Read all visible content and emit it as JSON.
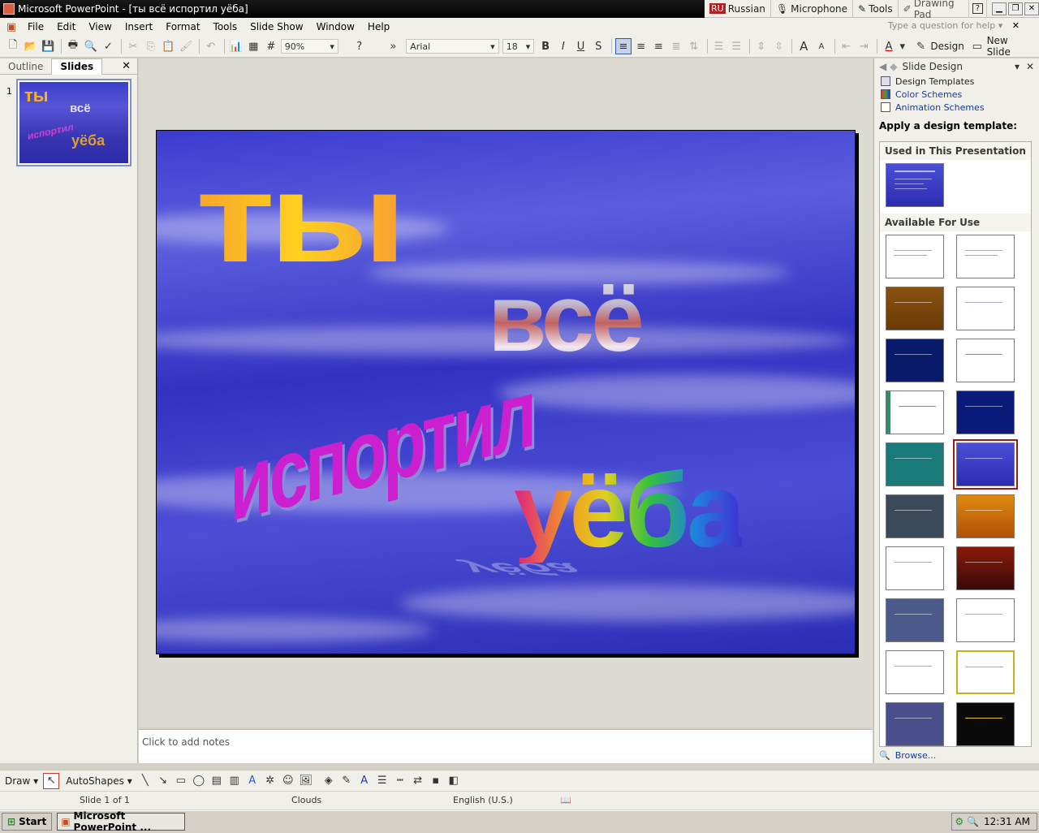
{
  "window": {
    "title": "Microsoft PowerPoint - [ты всё испортил уёба]"
  },
  "langbar": {
    "lang_code": "RU",
    "lang_name": "Russian",
    "microphone": "Microphone",
    "tools": "Tools",
    "drawing_pad": "Drawing Pad"
  },
  "menu": {
    "items": [
      "File",
      "Edit",
      "View",
      "Insert",
      "Format",
      "Tools",
      "Slide Show",
      "Window",
      "Help"
    ],
    "help_placeholder": "Type a question for help"
  },
  "toolbar": {
    "zoom": "90%",
    "font": "Arial",
    "size": "18",
    "design": "Design",
    "new_slide": "New Slide"
  },
  "leftpane": {
    "tabs": [
      "Outline",
      "Slides"
    ],
    "active_tab": "Slides",
    "slide_number": "1"
  },
  "slide": {
    "word1": "ты",
    "word2": "всё",
    "word3": "испортил",
    "word4": "уёба"
  },
  "notes": {
    "placeholder": "Click to add notes"
  },
  "taskpane": {
    "title": "Slide Design",
    "links": [
      "Design Templates",
      "Color Schemes",
      "Animation Schemes"
    ],
    "apply_label": "Apply a design template:",
    "used_section": "Used in This Presentation",
    "available_section": "Available For Use",
    "browse": "Browse..."
  },
  "drawbar": {
    "draw": "Draw",
    "autoshapes": "AutoShapes"
  },
  "status": {
    "slide": "Slide 1 of 1",
    "design": "Clouds",
    "language": "English (U.S.)"
  },
  "taskbar": {
    "start": "Start",
    "item": "Microsoft PowerPoint ...",
    "clock": "12:31 AM"
  },
  "colors": {
    "slide_bg": "#3b3cd0",
    "selection": "#9c1a1a",
    "link": "#1a3c9a"
  }
}
